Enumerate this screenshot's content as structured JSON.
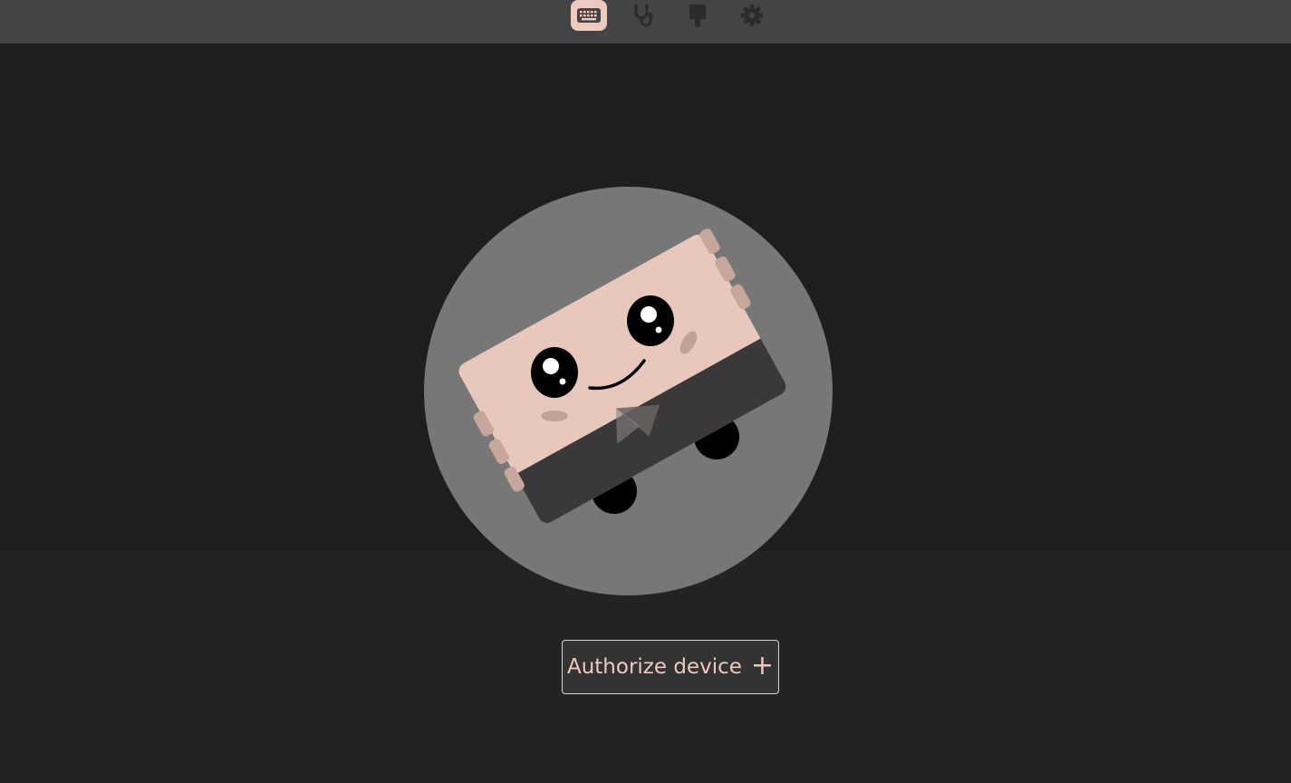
{
  "topbar": {
    "nav": [
      {
        "icon": "keyboard-icon",
        "active": true
      },
      {
        "icon": "stethoscope-icon",
        "active": false
      },
      {
        "icon": "paint-brush-icon",
        "active": false
      },
      {
        "icon": "gear-icon",
        "active": false
      }
    ]
  },
  "main": {
    "authorize_label": "Authorize device",
    "authorize_icon": "+"
  },
  "colors": {
    "accent": "#efc9be",
    "topbar_bg": "#444444",
    "main_bg": "#1f1e1f",
    "icon_inactive": "#2b2b2b"
  }
}
